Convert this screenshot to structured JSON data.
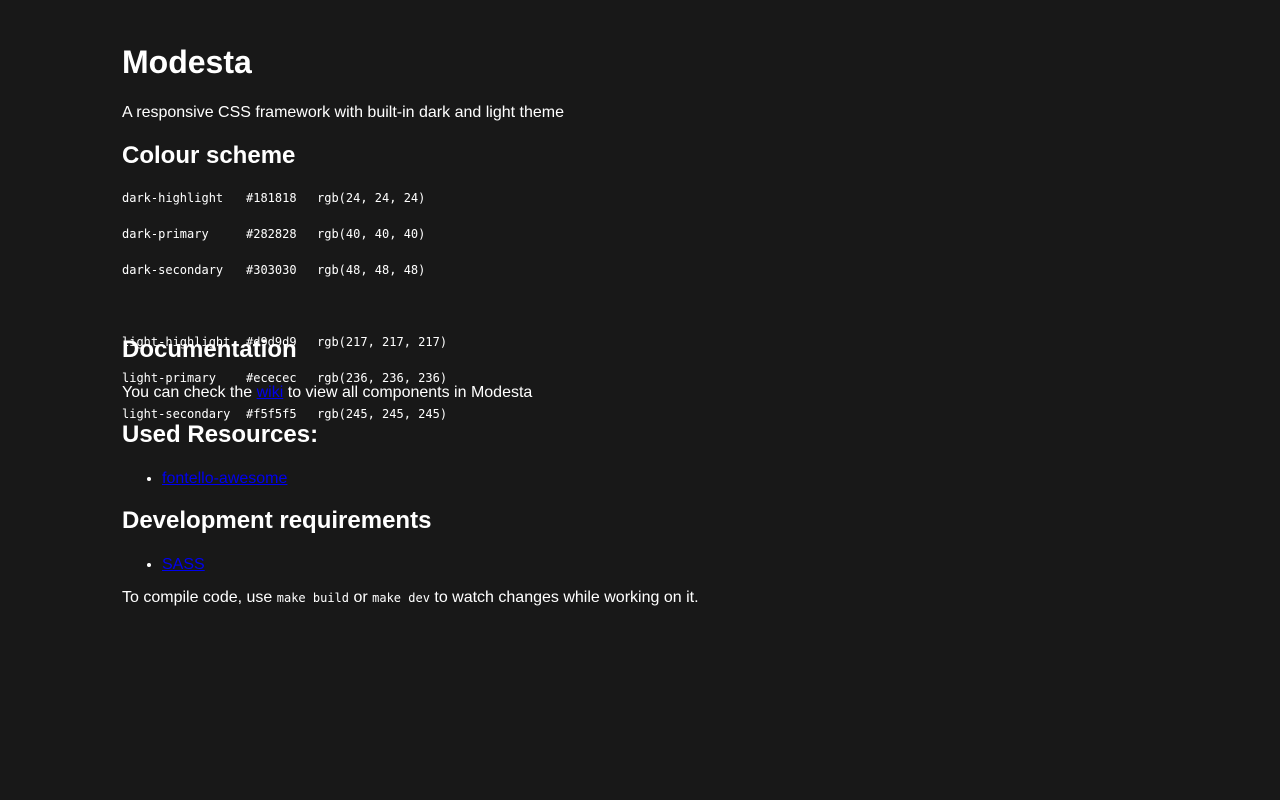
{
  "title": "Modesta",
  "subtitle": "A responsive CSS framework with built-in dark and light theme",
  "colour_scheme": {
    "heading": "Colour scheme",
    "dark": [
      {
        "name": "dark-highlight",
        "hex": "#181818",
        "rgb": "rgb(24, 24, 24)"
      },
      {
        "name": "dark-primary",
        "hex": "#282828",
        "rgb": "rgb(40, 40, 40)"
      },
      {
        "name": "dark-secondary",
        "hex": "#303030",
        "rgb": "rgb(48, 48, 48)"
      }
    ],
    "light": [
      {
        "name": "light-highlight",
        "hex": "#d9d9d9",
        "rgb": "rgb(217, 217, 217)"
      },
      {
        "name": "light-primary",
        "hex": "#ececec",
        "rgb": "rgb(236, 236, 236)"
      },
      {
        "name": "light-secondary",
        "hex": "#f5f5f5",
        "rgb": "rgb(245, 245, 245)"
      }
    ]
  },
  "documentation": {
    "heading": "Documentation",
    "text_before": "You can check the ",
    "link": "wiki",
    "text_after": " to view all components in Modesta"
  },
  "resources": {
    "heading": "Used Resources:",
    "items": [
      "fontello-awesome"
    ]
  },
  "dev": {
    "heading": "Development requirements",
    "items": [
      "SASS"
    ],
    "text_1": "To compile code, use ",
    "code_1": "make build",
    "text_2": " or ",
    "code_2": "make dev",
    "text_3": " to watch changes while working on it."
  },
  "colors": {
    "background": "#181818",
    "text": "#ffffff",
    "link": "#0000ee"
  }
}
